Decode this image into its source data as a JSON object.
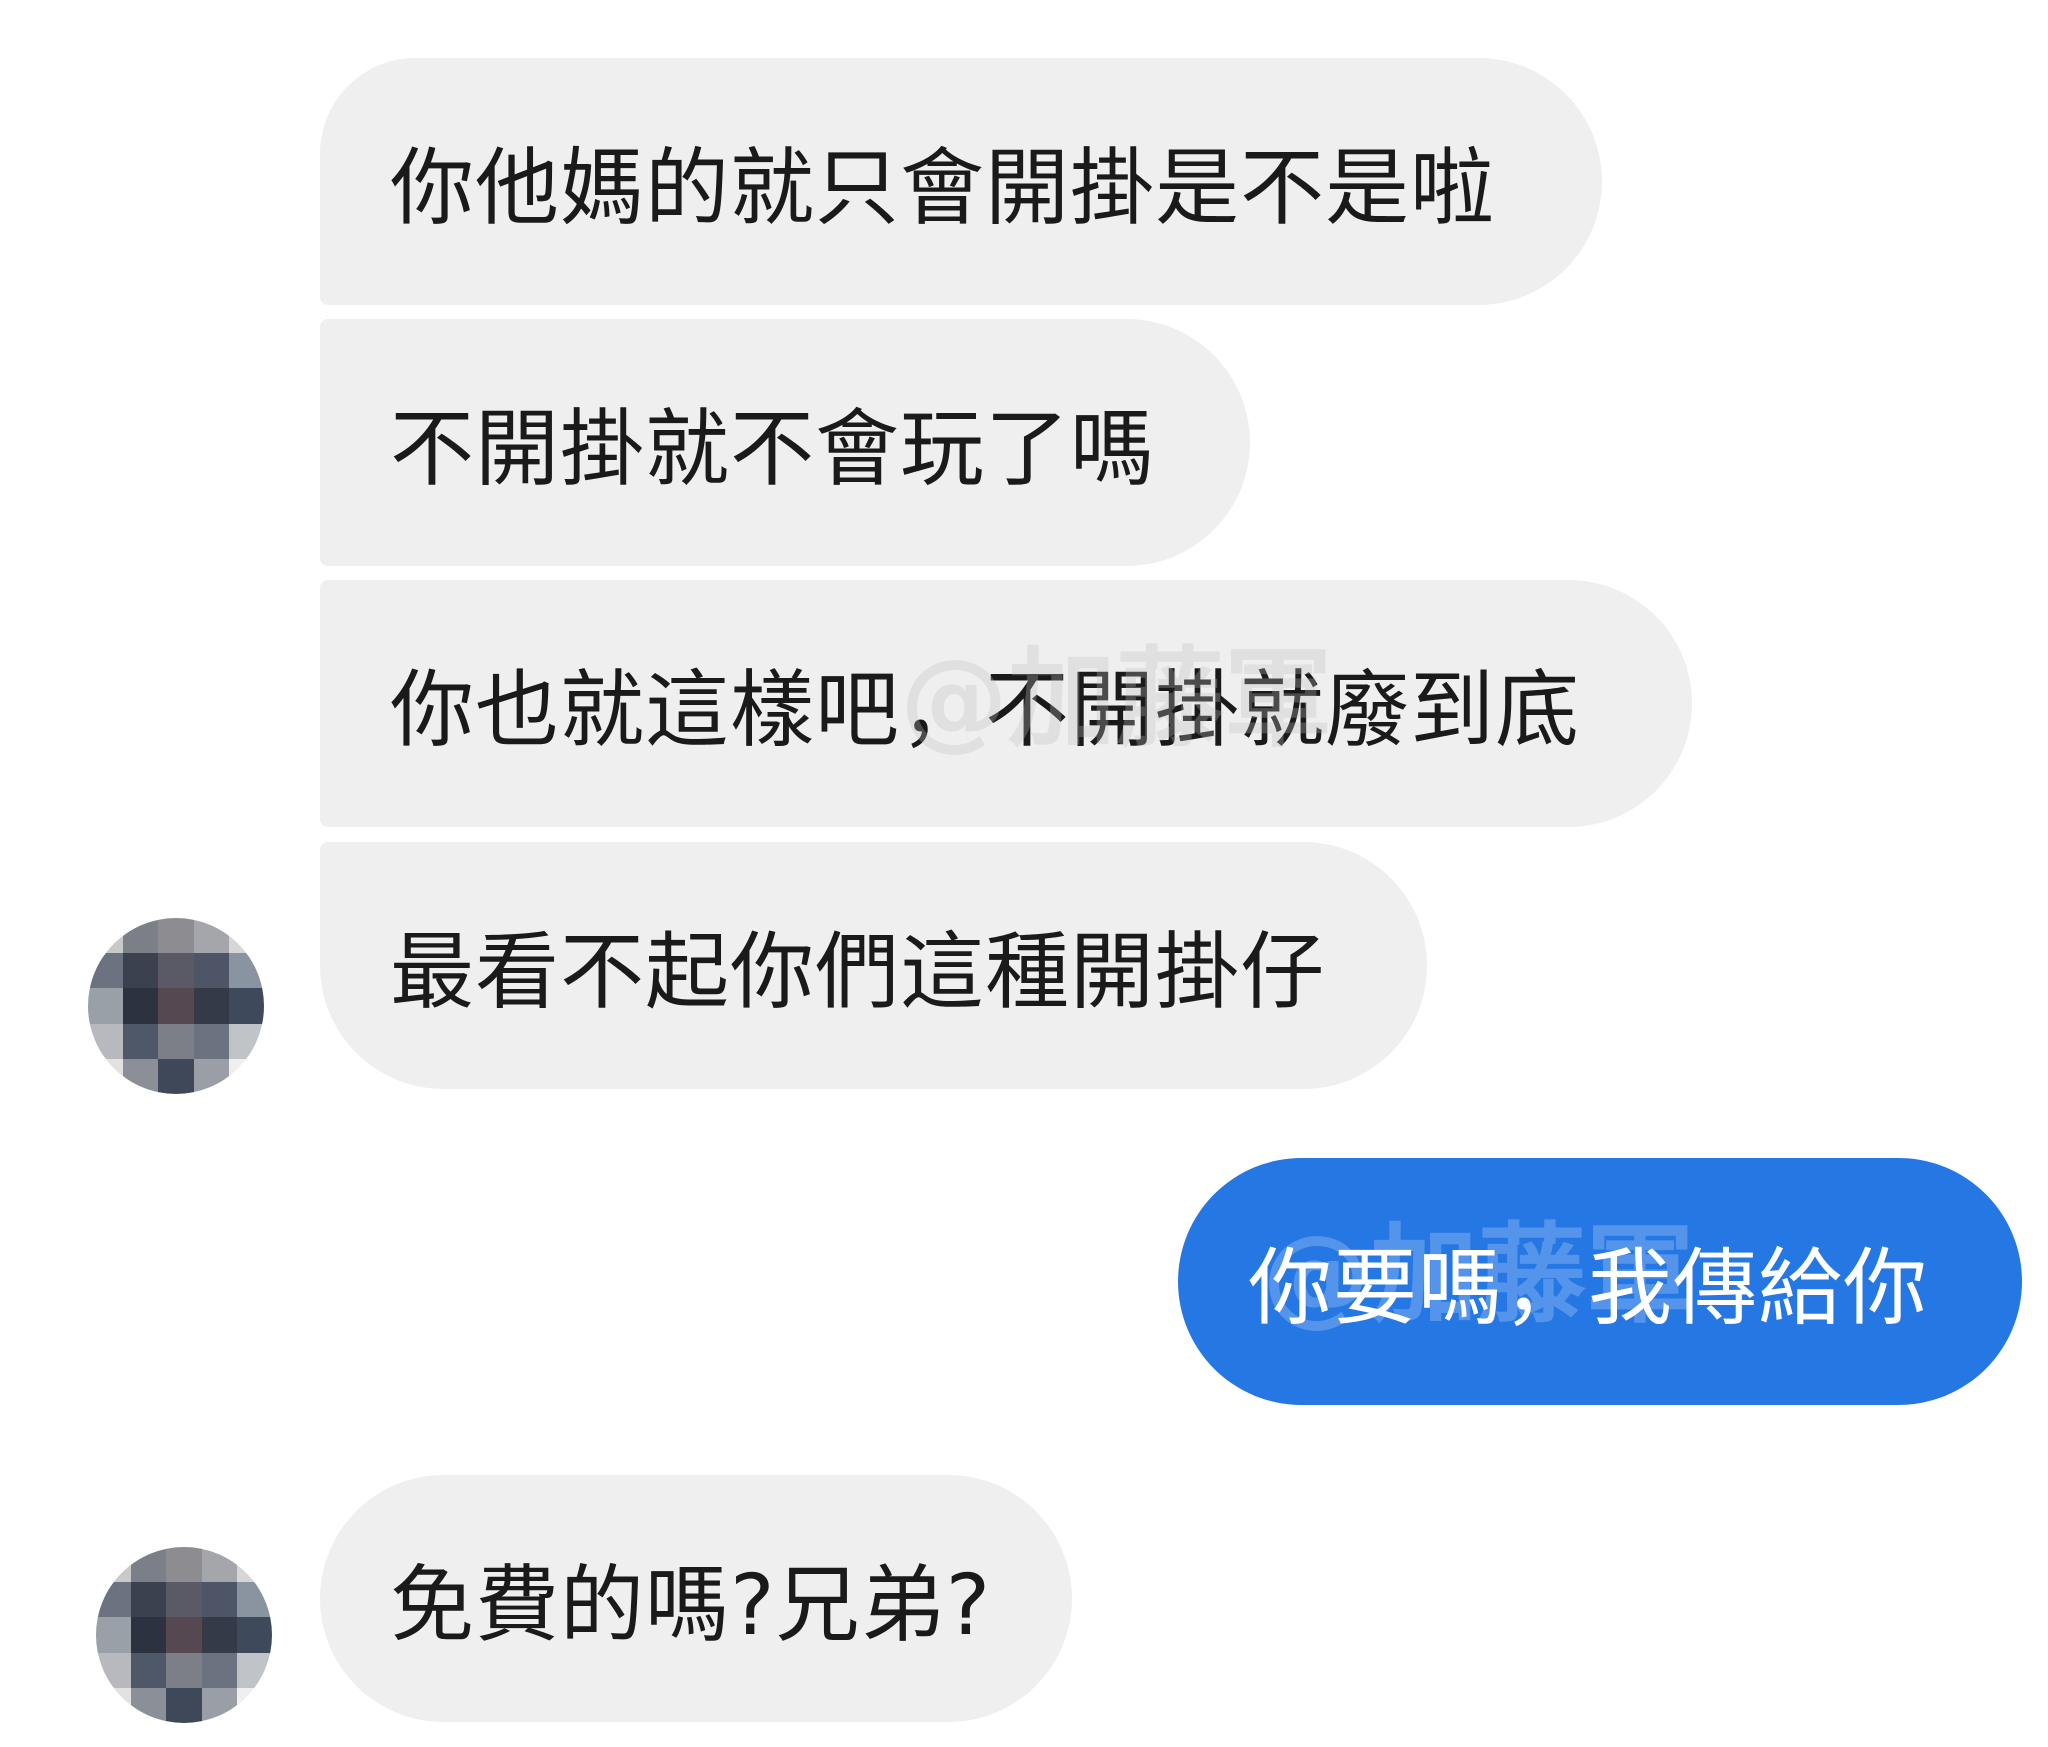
{
  "messages": [
    {
      "side": "incoming",
      "text": "你他媽的就只會開掛是不是啦"
    },
    {
      "side": "incoming",
      "text": "不開掛就不會玩了嗎"
    },
    {
      "side": "incoming",
      "text": "你也就這樣吧，不開掛就廢到底"
    },
    {
      "side": "incoming",
      "text": "最看不起你們這種開掛仔"
    },
    {
      "side": "outgoing",
      "text": "你要嗎，我傳給你"
    },
    {
      "side": "incoming",
      "text": "免費的嗎?兄弟?"
    }
  ],
  "watermark": "@加藤軍",
  "colors": {
    "incoming_bubble": "#efefef",
    "outgoing_bubble": "#2577e4",
    "incoming_text": "#1a1a1a",
    "outgoing_text": "#ffffff"
  },
  "avatar": {
    "style": "pixelated"
  }
}
